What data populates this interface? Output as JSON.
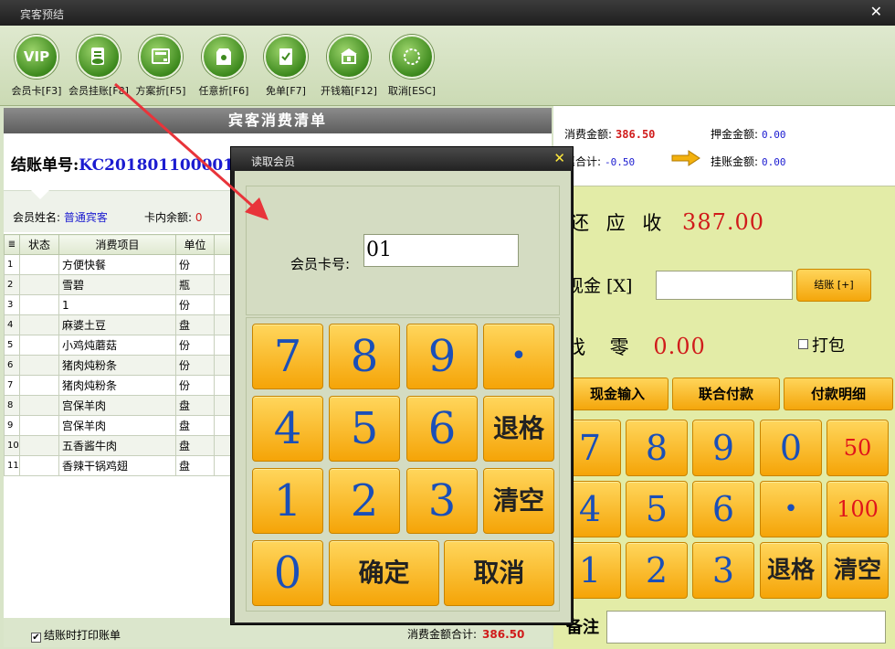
{
  "window": {
    "title": "宾客预结"
  },
  "toolbar": [
    {
      "label": "会员卡[F3]",
      "icon": "vip-icon",
      "glyph": "VIP"
    },
    {
      "label": "会员挂账[F8]",
      "icon": "member-charge-icon",
      "glyph": ""
    },
    {
      "label": "方案折[F5]",
      "icon": "plan-discount-icon",
      "glyph": ""
    },
    {
      "label": "任意折[F6]",
      "icon": "custom-discount-icon",
      "glyph": ""
    },
    {
      "label": "免单[F7]",
      "icon": "free-order-icon",
      "glyph": ""
    },
    {
      "label": "开钱箱[F12]",
      "icon": "cash-drawer-icon",
      "glyph": ""
    },
    {
      "label": "取消[ESC]",
      "icon": "cancel-icon",
      "glyph": ""
    }
  ],
  "bill": {
    "header": "宾客消费清单",
    "bill_no_label": "结账单号:",
    "bill_no": "KC201801100001",
    "member_name_label": "会员姓名:",
    "member_name": "普通宾客",
    "card_balance_label": "卡内余额:",
    "card_balance": "0",
    "columns": [
      "状态",
      "消费项目",
      "单位"
    ],
    "rows": [
      {
        "idx": "1",
        "status": "",
        "item": "方便快餐",
        "unit": "份"
      },
      {
        "idx": "2",
        "status": "",
        "item": "雪碧",
        "unit": "瓶"
      },
      {
        "idx": "3",
        "status": "",
        "item": "1",
        "unit": "份"
      },
      {
        "idx": "4",
        "status": "",
        "item": "麻婆土豆",
        "unit": "盘"
      },
      {
        "idx": "5",
        "status": "",
        "item": "小鸡炖蘑菇",
        "unit": "份"
      },
      {
        "idx": "6",
        "status": "",
        "item": "猪肉炖粉条",
        "unit": "份"
      },
      {
        "idx": "7",
        "status": "",
        "item": "猪肉炖粉条",
        "unit": "份"
      },
      {
        "idx": "8",
        "status": "",
        "item": "宫保羊肉",
        "unit": "盘"
      },
      {
        "idx": "9",
        "status": "",
        "item": "宫保羊肉",
        "unit": "盘"
      },
      {
        "idx": "10",
        "status": "",
        "item": "五香酱牛肉",
        "unit": "盘"
      },
      {
        "idx": "11",
        "status": "",
        "item": "香辣干锅鸡翅",
        "unit": "盘"
      }
    ],
    "print_on_checkout_label": "结账时打印账单",
    "print_on_checkout_checked": "✔",
    "total_label": "消费金额合计:",
    "total_value": "386.50"
  },
  "summary": {
    "consume_label": "消费金额:",
    "consume_value": "386.50",
    "deposit_label": "押金金额:",
    "deposit_value": "0.00",
    "discount_label": "惠合计:",
    "discount_value": "-0.50",
    "charge_label": "挂账金额:",
    "charge_value": "0.00"
  },
  "payment": {
    "due_label": "还 应 收",
    "due_value": "387.00",
    "cash_label": "现金 [X]",
    "cash_value": "",
    "settle_label": "结账 [+]",
    "change_label": "找 零",
    "change_value": "0.00",
    "pack_label": "打包",
    "tabs": [
      "现金输入",
      "联合付款",
      "付款明细"
    ],
    "keypad": [
      [
        "7",
        "8",
        "9",
        "0",
        "50"
      ],
      [
        "4",
        "5",
        "6",
        "•",
        "100"
      ],
      [
        "1",
        "2",
        "3",
        "退格",
        "清空"
      ]
    ],
    "remark_label": "备注",
    "remark_value": ""
  },
  "dialog": {
    "title": "读取会员",
    "close": "✕",
    "card_no_label": "会员卡号:",
    "card_no_value": "01",
    "keys": {
      "k7": "7",
      "k8": "8",
      "k9": "9",
      "kdot": "•",
      "k4": "4",
      "k5": "5",
      "k6": "6",
      "kback": "退格",
      "k1": "1",
      "k2": "2",
      "k3": "3",
      "kclear": "清空",
      "k0": "0",
      "kok": "确定",
      "kcancel": "取消"
    }
  },
  "colors": {
    "accent_red": "#d01b1b",
    "accent_blue": "#1b1bd0",
    "key_orange": "#f5a407",
    "arrow": "#e8343a"
  }
}
